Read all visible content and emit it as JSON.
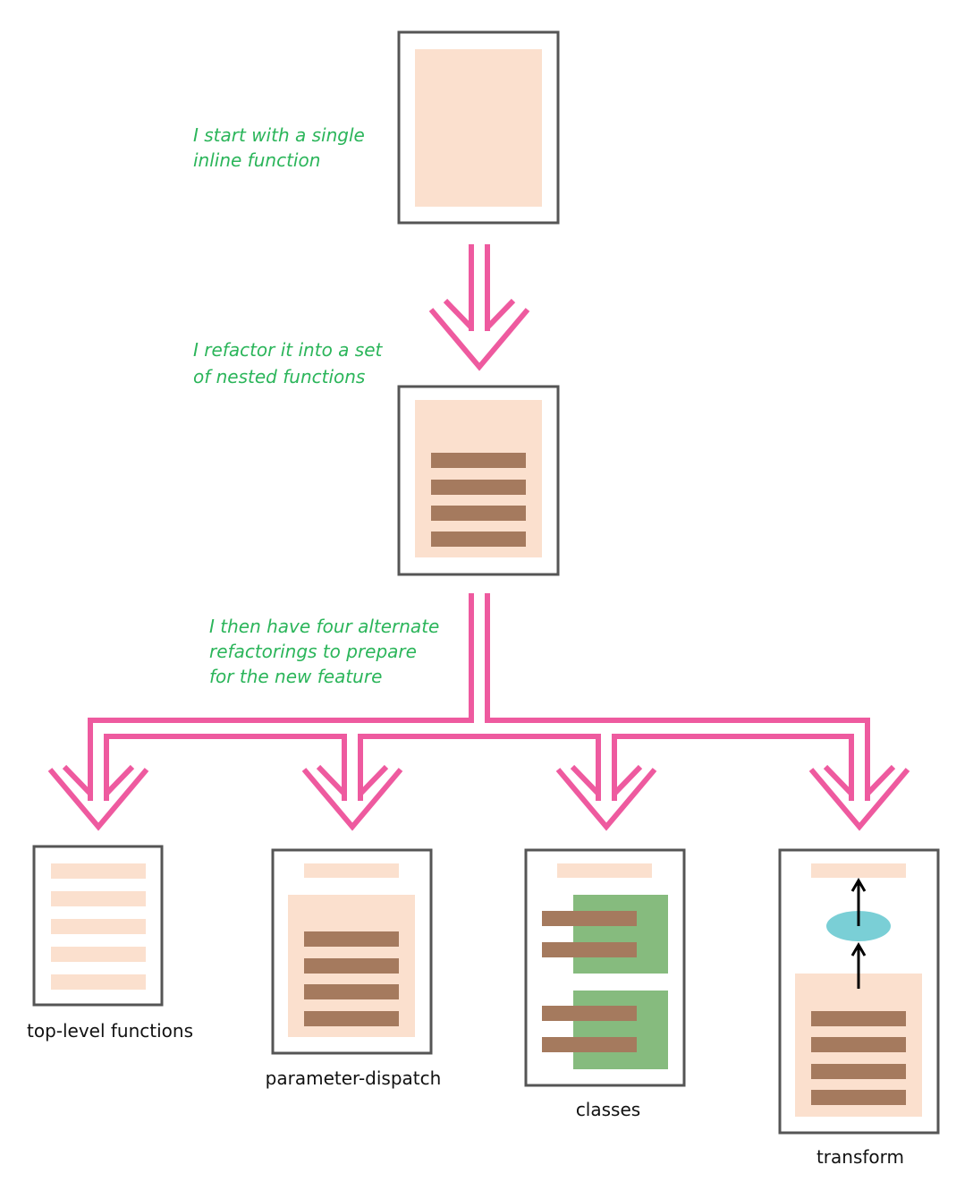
{
  "colors": {
    "arrow": "#ee5a9f",
    "note_text": "#2bb55a",
    "box_border": "#555555",
    "peach": "#fbe0ce",
    "brown": "#a57a5e",
    "green": "#86bb7e",
    "cyan": "#7acfd6"
  },
  "notes": {
    "start": [
      "I start with a single",
      "inline function"
    ],
    "refactor": [
      "I refactor it into a set",
      "of nested functions"
    ],
    "alternates": [
      "I then have four alternate",
      "refactorings to prepare",
      "for the new feature"
    ]
  },
  "alternatives": [
    {
      "label": "top-level functions"
    },
    {
      "label": "parameter-dispatch"
    },
    {
      "label": "classes"
    },
    {
      "label": "transform"
    }
  ]
}
